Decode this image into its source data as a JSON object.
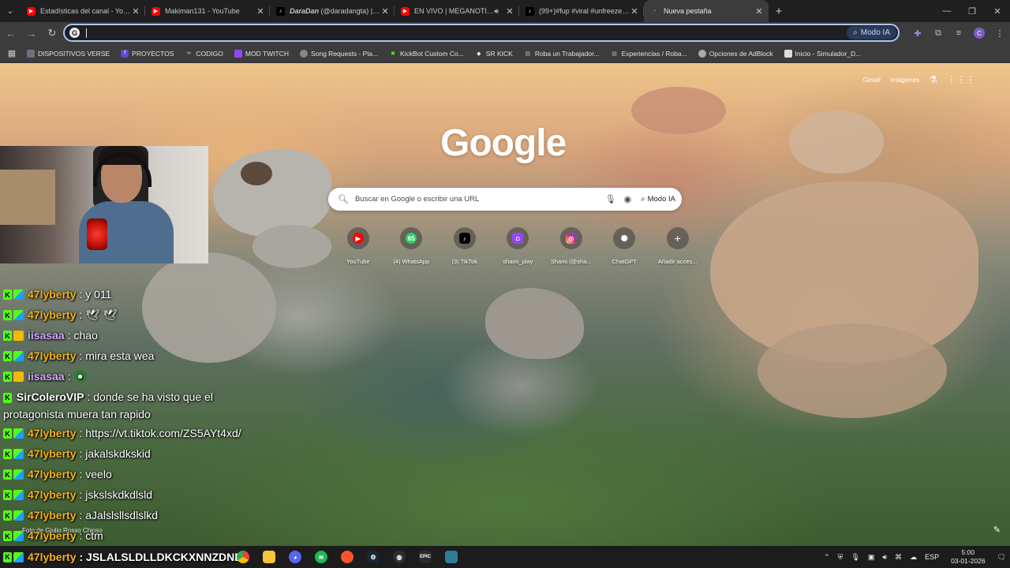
{
  "tabs": [
    {
      "title": "Estadísticas del canal - YouTube",
      "icon": "youtube-icon",
      "active": false
    },
    {
      "title": "Makiman131 - YouTube",
      "icon": "youtube-icon",
      "active": false
    },
    {
      "title_bold": "DaraDan",
      "title": " (@daradangta) | TikT",
      "icon": "tiktok-icon",
      "active": false
    },
    {
      "title": "EN VIVO | MEGANOTICIAS A",
      "icon": "youtube-icon",
      "active": false,
      "audio": true
    },
    {
      "title": "(99+)#fup #viral #unfreezemyac",
      "icon": "tiktok-icon",
      "active": false
    },
    {
      "title": "Nueva pestaña",
      "icon": "newtab-icon",
      "active": true
    }
  ],
  "omnibox": {
    "value": "",
    "modo_ia": "Modo IA"
  },
  "bookmarks": [
    {
      "label": "DISPOSITIVOS VERSE",
      "color": "#6b7280"
    },
    {
      "label": "PROYECTOS",
      "color": "#5b4bc4"
    },
    {
      "label": "CODIGO",
      "color": "#444"
    },
    {
      "label": "MOD TWITCH",
      "color": "#9146ff"
    },
    {
      "label": "Song Requests - Pla...",
      "color": "#888"
    },
    {
      "label": "KickBot Custom Co...",
      "color": "#53fc18"
    },
    {
      "label": "SR KICK",
      "color": "#eee"
    },
    {
      "label": "Roba un Trabajador...",
      "color": "#bbb"
    },
    {
      "label": "Experiencias / Roba...",
      "color": "#bbb"
    },
    {
      "label": "Opciones de AdBlock",
      "color": "#aaa"
    },
    {
      "label": "Inicio - Simulador_D...",
      "color": "#ddd"
    }
  ],
  "ntp": {
    "links": [
      "Gmail",
      "Imágenes"
    ],
    "logo": "Google",
    "search_placeholder": "Buscar en Google o escribir una URL",
    "modo_ia": "Modo IA",
    "shortcuts": [
      {
        "label": "YouTube",
        "icon": "youtube-icon",
        "bg": "#ff0000",
        "glyph": "▶"
      },
      {
        "label": "(4) WhatsApp",
        "icon": "whatsapp-icon",
        "bg": "#25d366",
        "glyph": "65"
      },
      {
        "label": "(3) TikTok",
        "icon": "tiktok-icon",
        "bg": "#000000",
        "glyph": "♪"
      },
      {
        "label": "shami_play",
        "icon": "twitch-icon",
        "bg": "#9146ff",
        "glyph": "◘"
      },
      {
        "label": "Shami (@sha...",
        "icon": "instagram-icon",
        "bg": "#e1306c",
        "glyph": "◎"
      },
      {
        "label": "ChatGPT",
        "icon": "chatgpt-icon",
        "bg": "#555555",
        "glyph": "✺"
      },
      {
        "label": "Añadir acces...",
        "icon": "add-icon",
        "bg": "transparent",
        "glyph": "+"
      }
    ],
    "photo_credit": "Foto de Giulio Rosso Chioso"
  },
  "chat": [
    {
      "user": "47lyberty",
      "color": "gold",
      "text": ": y 011",
      "badges": 2
    },
    {
      "user": "47lyberty",
      "color": "gold",
      "text": ":",
      "badges": 2,
      "emote": "bird"
    },
    {
      "user": "iisasaa",
      "color": "lilac",
      "text": ": chao",
      "badges": 3
    },
    {
      "user": "47lyberty",
      "color": "gold",
      "text": ": mira esta wea",
      "badges": 2
    },
    {
      "user": "iisasaa",
      "color": "lilac",
      "text": ":",
      "badges": 3,
      "emote": "green"
    },
    {
      "user": "SirColeroVIP",
      "color": "white",
      "text": ": donde se ha visto que el protagonista muera tan rapido",
      "badges": 1,
      "wrap": true
    },
    {
      "user": "47lyberty",
      "color": "gold",
      "text": ": https://vt.tiktok.com/ZS5AYt4xd/",
      "badges": 2
    },
    {
      "user": "47lyberty",
      "color": "gold",
      "text": ": jakalskdkskid",
      "badges": 2
    },
    {
      "user": "47lyberty",
      "color": "gold",
      "text": ": veelo",
      "badges": 2
    },
    {
      "user": "47lyberty",
      "color": "gold",
      "text": ": jskslskdkdlsld",
      "badges": 2
    },
    {
      "user": "47lyberty",
      "color": "gold",
      "text": ": aJalslsllsdlslkd",
      "badges": 2
    },
    {
      "user": "47lyberty",
      "color": "gold",
      "text": ": ctm",
      "badges": 2
    }
  ],
  "taskbar_chat": {
    "user": "47lyberty",
    "text": ": JSLALSLDLLDKCKXNNZDND"
  },
  "tray": {
    "lang": "ESP",
    "time": "5:00",
    "date": "03-01-2026"
  }
}
